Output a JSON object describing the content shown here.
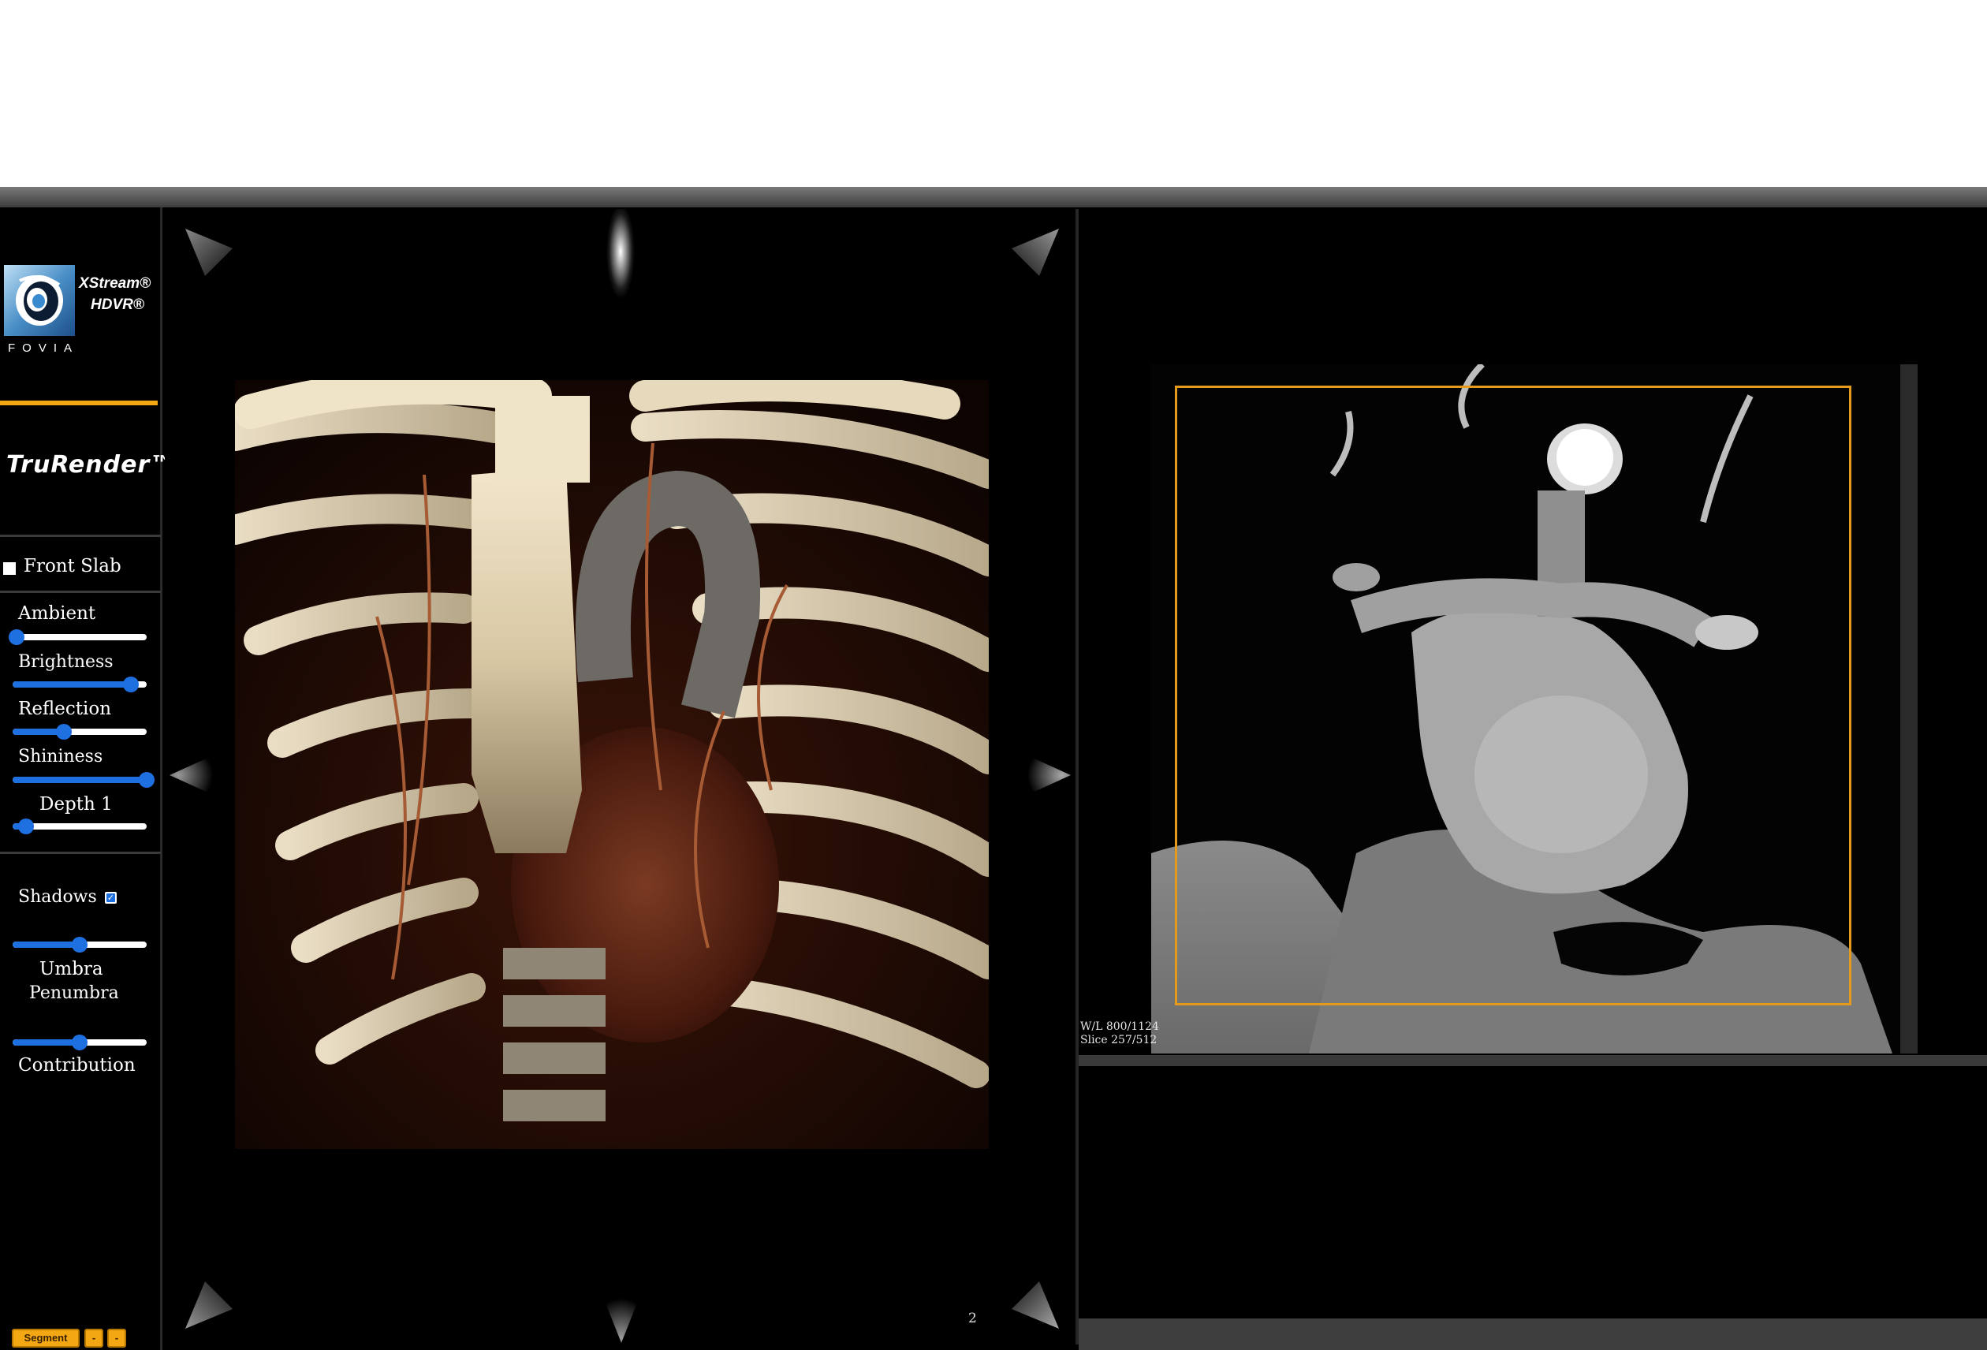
{
  "brand": {
    "logo_text": "FOVIA",
    "product_line1": "XStream®",
    "product_line2": "HDVR®",
    "module_title": "TruRender™"
  },
  "controls": {
    "front_slab_label": "Front Slab",
    "front_slab_checked": false,
    "ambient_label": "Ambient",
    "ambient_value": 0.03,
    "brightness_label": "Brightness",
    "brightness_value": 0.88,
    "reflection_label": "Reflection",
    "reflection_value": 0.38,
    "shininess_label": "Shininess",
    "shininess_value": 1.0,
    "depth_label": "Depth 1",
    "depth_value": 0.1,
    "shadows_label": "Shadows",
    "shadows_checked": true,
    "umbra_value": 0.5,
    "umbra_label": "Umbra",
    "penumbra_label": "Penumbra",
    "contribution_value": 0.5,
    "contribution_label": "Contribution"
  },
  "buttons": {
    "segment_label": "Segment",
    "minus1_label": "-",
    "minus2_label": "-"
  },
  "viewport_3d": {
    "index_label": "2"
  },
  "viewport_2d": {
    "window_level": "W/L 800/1124",
    "slice_info": "Slice 257/512"
  },
  "colors": {
    "accent_orange": "#f3a712",
    "slider_blue": "#1e6fe0",
    "roi_box": "#e69a1c"
  }
}
